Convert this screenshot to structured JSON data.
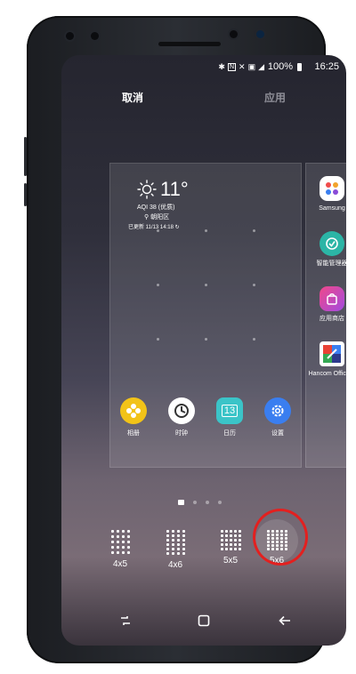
{
  "status": {
    "battery": "100%",
    "time": "16:25"
  },
  "toolbar": {
    "cancel_label": "取消",
    "apply_label": "应用"
  },
  "weather": {
    "temperature": "11°",
    "aqi": "AQI 38 (优质)",
    "location": "朝阳区",
    "updated": "已更新 11/13 14:18"
  },
  "home_apps": [
    {
      "label": "相册",
      "icon": "gallery-icon",
      "color": "#f2c318"
    },
    {
      "label": "时钟",
      "icon": "clock-icon",
      "color": "#ffffff"
    },
    {
      "label": "日历",
      "icon": "calendar-icon",
      "color": "#3bc4c8",
      "day": "13"
    },
    {
      "label": "设置",
      "icon": "settings-icon",
      "color": "#3a7ef0"
    }
  ],
  "side_apps": [
    {
      "label": "Samsung",
      "icon": "samsung-folder-icon"
    },
    {
      "label": "智能管理器",
      "icon": "smart-manager-icon"
    },
    {
      "label": "应用商店",
      "icon": "app-store-icon"
    },
    {
      "label": "Hancom Office S",
      "icon": "hancom-office-icon"
    }
  ],
  "grid_options": [
    {
      "label": "4x5"
    },
    {
      "label": "4x6"
    },
    {
      "label": "5x5"
    },
    {
      "label": "5x6",
      "selected": true
    }
  ],
  "colors": {
    "highlight": "#e3201f"
  }
}
